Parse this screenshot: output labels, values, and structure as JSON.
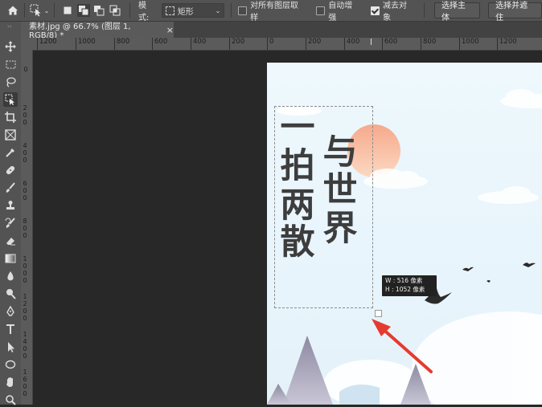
{
  "options_bar": {
    "mode_label": "模式:",
    "mode_value": "矩形",
    "sample_all_layers_label": "对所有图层取样",
    "sample_all_layers_checked": false,
    "auto_enhance_label": "自动增强",
    "auto_enhance_checked": false,
    "subtract_object_label": "减去对象",
    "subtract_object_checked": true,
    "select_subject_label": "选择主体",
    "select_and_mask_label": "选择并遮住"
  },
  "document_tab": {
    "title": "素材.jpg @ 66.7% (图层 1, RGB/8) *",
    "close_glyph": "×"
  },
  "ruler_h_labels": [
    "1200",
    "1000",
    "800",
    "600",
    "400",
    "200",
    "0",
    "200",
    "400",
    "600",
    "800",
    "1000",
    "1200"
  ],
  "ruler_v_labels": [
    "0",
    "200",
    "400",
    "600",
    "800",
    "1000",
    "1200",
    "1400",
    "1600"
  ],
  "poem": {
    "col1": [
      "一",
      "拍",
      "两",
      "散"
    ],
    "col2": [
      "与",
      "世",
      "界"
    ]
  },
  "size_tooltip": {
    "width": "W :   516 像素",
    "height": "H : 1052 像素"
  },
  "colors": {
    "app_bg": "#282828",
    "panel": "#535353",
    "canvas_sky": "#eaf6fc",
    "sun": "#f3a487",
    "mountain": "#9b97ad",
    "arrow": "#e53b2f"
  },
  "tools": [
    "move-tool",
    "marquee-tool",
    "lasso-tool",
    "object-selection-tool",
    "crop-tool",
    "frame-tool",
    "eyedropper-tool",
    "healing-brush-tool",
    "brush-tool",
    "clone-stamp-tool",
    "history-brush-tool",
    "eraser-tool",
    "gradient-tool",
    "blur-tool",
    "dodge-tool",
    "pen-tool",
    "type-tool",
    "path-selection-tool",
    "shape-tool",
    "hand-tool",
    "zoom-tool"
  ]
}
